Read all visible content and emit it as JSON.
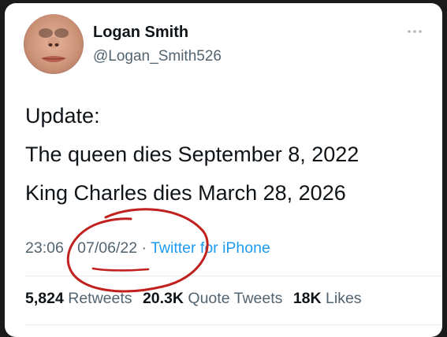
{
  "user": {
    "display_name": "Logan Smith",
    "handle": "@Logan_Smith526"
  },
  "tweet": {
    "lines": [
      "Update:",
      "The queen dies September 8, 2022",
      "King Charles dies March 28, 2026"
    ],
    "time": "23:06",
    "separator": "·",
    "date": "07/06/22",
    "source": "Twitter for iPhone"
  },
  "stats": {
    "retweets_count": "5,824",
    "retweets_label": "Retweets",
    "quotes_count": "20.3K",
    "quotes_label": "Quote Tweets",
    "likes_count": "18K",
    "likes_label": "Likes"
  },
  "icons": {
    "more": "more-horizontal-icon",
    "annotation": "red-circle-annotation"
  },
  "colors": {
    "link": "#1d9bf0",
    "text": "#0f1419",
    "muted": "#536471",
    "annotation": "#c0211f"
  }
}
